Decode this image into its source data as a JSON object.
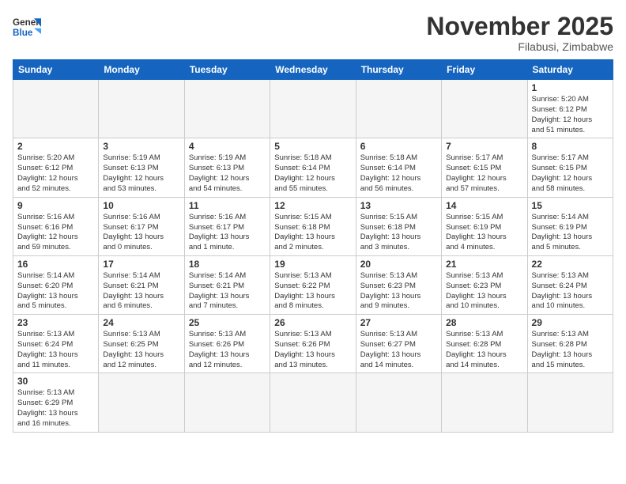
{
  "logo": {
    "general": "General",
    "blue": "Blue"
  },
  "header": {
    "title": "November 2025",
    "subtitle": "Filabusi, Zimbabwe"
  },
  "weekdays": [
    "Sunday",
    "Monday",
    "Tuesday",
    "Wednesday",
    "Thursday",
    "Friday",
    "Saturday"
  ],
  "weeks": [
    [
      {
        "day": "",
        "info": "",
        "empty": true
      },
      {
        "day": "",
        "info": "",
        "empty": true
      },
      {
        "day": "",
        "info": "",
        "empty": true
      },
      {
        "day": "",
        "info": "",
        "empty": true
      },
      {
        "day": "",
        "info": "",
        "empty": true
      },
      {
        "day": "",
        "info": "",
        "empty": true
      },
      {
        "day": "1",
        "info": "Sunrise: 5:20 AM\nSunset: 6:12 PM\nDaylight: 12 hours\nand 51 minutes."
      }
    ],
    [
      {
        "day": "2",
        "info": "Sunrise: 5:20 AM\nSunset: 6:12 PM\nDaylight: 12 hours\nand 52 minutes."
      },
      {
        "day": "3",
        "info": "Sunrise: 5:19 AM\nSunset: 6:13 PM\nDaylight: 12 hours\nand 53 minutes."
      },
      {
        "day": "4",
        "info": "Sunrise: 5:19 AM\nSunset: 6:13 PM\nDaylight: 12 hours\nand 54 minutes."
      },
      {
        "day": "5",
        "info": "Sunrise: 5:18 AM\nSunset: 6:14 PM\nDaylight: 12 hours\nand 55 minutes."
      },
      {
        "day": "6",
        "info": "Sunrise: 5:18 AM\nSunset: 6:14 PM\nDaylight: 12 hours\nand 56 minutes."
      },
      {
        "day": "7",
        "info": "Sunrise: 5:17 AM\nSunset: 6:15 PM\nDaylight: 12 hours\nand 57 minutes."
      },
      {
        "day": "8",
        "info": "Sunrise: 5:17 AM\nSunset: 6:15 PM\nDaylight: 12 hours\nand 58 minutes."
      }
    ],
    [
      {
        "day": "9",
        "info": "Sunrise: 5:16 AM\nSunset: 6:16 PM\nDaylight: 12 hours\nand 59 minutes."
      },
      {
        "day": "10",
        "info": "Sunrise: 5:16 AM\nSunset: 6:17 PM\nDaylight: 13 hours\nand 0 minutes."
      },
      {
        "day": "11",
        "info": "Sunrise: 5:16 AM\nSunset: 6:17 PM\nDaylight: 13 hours\nand 1 minute."
      },
      {
        "day": "12",
        "info": "Sunrise: 5:15 AM\nSunset: 6:18 PM\nDaylight: 13 hours\nand 2 minutes."
      },
      {
        "day": "13",
        "info": "Sunrise: 5:15 AM\nSunset: 6:18 PM\nDaylight: 13 hours\nand 3 minutes."
      },
      {
        "day": "14",
        "info": "Sunrise: 5:15 AM\nSunset: 6:19 PM\nDaylight: 13 hours\nand 4 minutes."
      },
      {
        "day": "15",
        "info": "Sunrise: 5:14 AM\nSunset: 6:19 PM\nDaylight: 13 hours\nand 5 minutes."
      }
    ],
    [
      {
        "day": "16",
        "info": "Sunrise: 5:14 AM\nSunset: 6:20 PM\nDaylight: 13 hours\nand 5 minutes."
      },
      {
        "day": "17",
        "info": "Sunrise: 5:14 AM\nSunset: 6:21 PM\nDaylight: 13 hours\nand 6 minutes."
      },
      {
        "day": "18",
        "info": "Sunrise: 5:14 AM\nSunset: 6:21 PM\nDaylight: 13 hours\nand 7 minutes."
      },
      {
        "day": "19",
        "info": "Sunrise: 5:13 AM\nSunset: 6:22 PM\nDaylight: 13 hours\nand 8 minutes."
      },
      {
        "day": "20",
        "info": "Sunrise: 5:13 AM\nSunset: 6:23 PM\nDaylight: 13 hours\nand 9 minutes."
      },
      {
        "day": "21",
        "info": "Sunrise: 5:13 AM\nSunset: 6:23 PM\nDaylight: 13 hours\nand 10 minutes."
      },
      {
        "day": "22",
        "info": "Sunrise: 5:13 AM\nSunset: 6:24 PM\nDaylight: 13 hours\nand 10 minutes."
      }
    ],
    [
      {
        "day": "23",
        "info": "Sunrise: 5:13 AM\nSunset: 6:24 PM\nDaylight: 13 hours\nand 11 minutes."
      },
      {
        "day": "24",
        "info": "Sunrise: 5:13 AM\nSunset: 6:25 PM\nDaylight: 13 hours\nand 12 minutes."
      },
      {
        "day": "25",
        "info": "Sunrise: 5:13 AM\nSunset: 6:26 PM\nDaylight: 13 hours\nand 12 minutes."
      },
      {
        "day": "26",
        "info": "Sunrise: 5:13 AM\nSunset: 6:26 PM\nDaylight: 13 hours\nand 13 minutes."
      },
      {
        "day": "27",
        "info": "Sunrise: 5:13 AM\nSunset: 6:27 PM\nDaylight: 13 hours\nand 14 minutes."
      },
      {
        "day": "28",
        "info": "Sunrise: 5:13 AM\nSunset: 6:28 PM\nDaylight: 13 hours\nand 14 minutes."
      },
      {
        "day": "29",
        "info": "Sunrise: 5:13 AM\nSunset: 6:28 PM\nDaylight: 13 hours\nand 15 minutes."
      }
    ],
    [
      {
        "day": "30",
        "info": "Sunrise: 5:13 AM\nSunset: 6:29 PM\nDaylight: 13 hours\nand 16 minutes."
      },
      {
        "day": "",
        "info": "",
        "empty": true
      },
      {
        "day": "",
        "info": "",
        "empty": true
      },
      {
        "day": "",
        "info": "",
        "empty": true
      },
      {
        "day": "",
        "info": "",
        "empty": true
      },
      {
        "day": "",
        "info": "",
        "empty": true
      },
      {
        "day": "",
        "info": "",
        "empty": true
      }
    ]
  ]
}
